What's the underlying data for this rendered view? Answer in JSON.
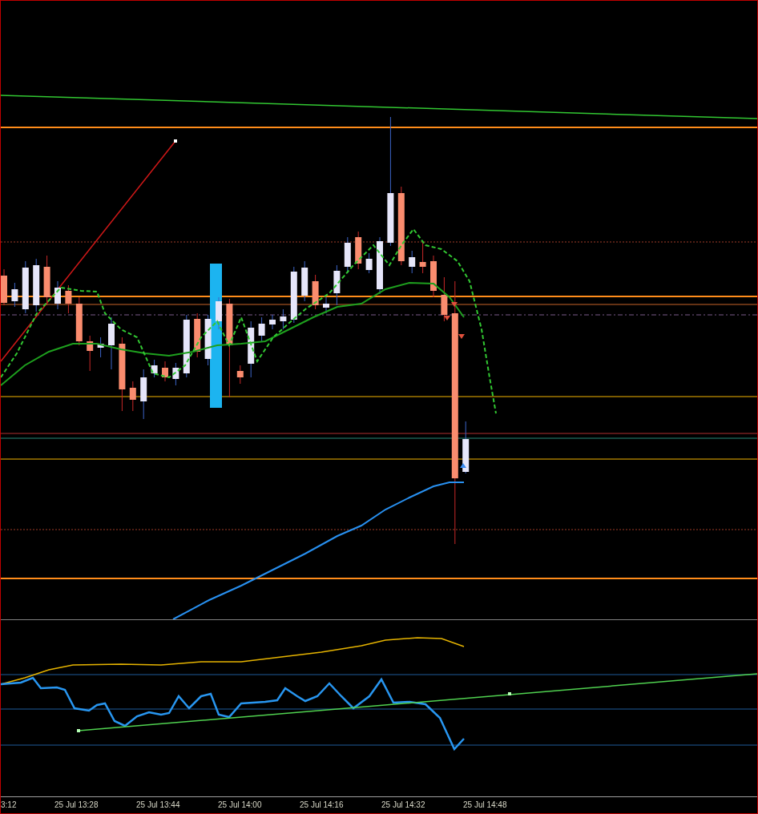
{
  "time_axis": {
    "labels": [
      "3:12",
      "25 Jul 13:28",
      "25 Jul 13:44",
      "25 Jul 14:00",
      "25 Jul 14:16",
      "25 Jul 14:32",
      "25 Jul 14:48"
    ]
  }
}
